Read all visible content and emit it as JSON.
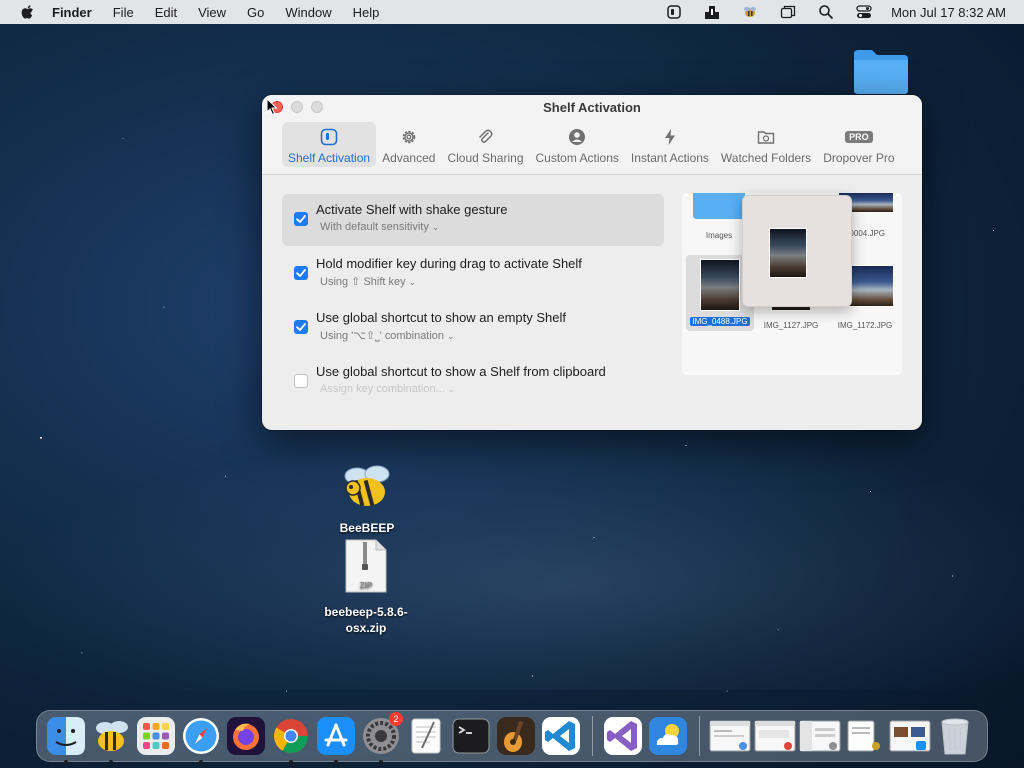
{
  "menubar": {
    "app_name": "Finder",
    "items": [
      "File",
      "Edit",
      "View",
      "Go",
      "Window",
      "Help"
    ],
    "clock": "Mon Jul 17  8:32 AM",
    "status_icons": [
      "dropover-icon",
      "upload-icon",
      "beebeep-icon",
      "window-icon",
      "search-icon",
      "control-center-icon"
    ]
  },
  "window": {
    "title": "Shelf Activation",
    "tabs": [
      {
        "label": "Shelf Activation",
        "icon": "shelf-icon",
        "active": true
      },
      {
        "label": "Advanced",
        "icon": "gear-icon"
      },
      {
        "label": "Cloud Sharing",
        "icon": "paperclip-icon"
      },
      {
        "label": "Custom Actions",
        "icon": "person-icon"
      },
      {
        "label": "Instant Actions",
        "icon": "bolt-icon"
      },
      {
        "label": "Watched Folders",
        "icon": "folder-sync-icon"
      },
      {
        "label": "Dropover Pro",
        "icon": "pro-badge",
        "badge": "PRO"
      }
    ],
    "options": [
      {
        "title": "Activate Shelf with shake gesture",
        "sub": "With default sensitivity",
        "checked": true
      },
      {
        "title": "Hold modifier key during drag to activate Shelf",
        "sub": "Using ⇧ Shift key",
        "checked": true
      },
      {
        "title": "Use global shortcut to show an empty Shelf",
        "sub": "Using '⌥⇧⎵' combination",
        "checked": true
      },
      {
        "title": "Use global shortcut to show a Shelf from clipboard",
        "sub": "Assign key combination...",
        "checked": false
      }
    ],
    "preview": {
      "images_label": "Images",
      "file_0004": "_0004.JPG",
      "file_0488": "IMG_0488.JPG",
      "file_1127": "IMG_1127.JPG",
      "file_1172": "IMG_1172.JPG"
    }
  },
  "desktop": {
    "beebeep_label": "BeeBEEP",
    "zip_label_line1": "beebeep-5.8.6-",
    "zip_label_line2": "osx.zip",
    "zip_text": "ZIP"
  },
  "dock": {
    "apps": [
      "Finder",
      "BeeBEEP",
      "Launchpad",
      "Safari",
      "Firefox",
      "Chrome",
      "App Store",
      "System Preferences",
      "TextEdit",
      "Terminal",
      "GarageBand",
      "Visual Studio Code",
      "Visual Studio",
      "Weather"
    ],
    "system_prefs_badge": "2"
  },
  "colors": {
    "accent": "#1e7cf2",
    "close": "#fe5f57",
    "desktop": "#14304f"
  }
}
